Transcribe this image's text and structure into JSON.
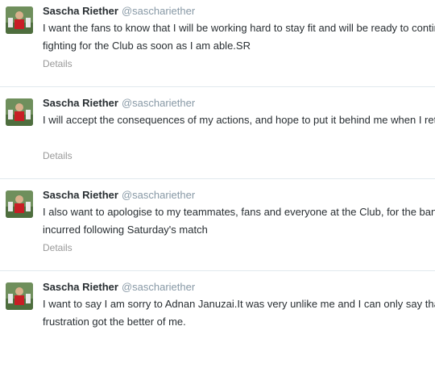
{
  "tweets": [
    {
      "name": "Sascha Riether",
      "handle": "@saschariether",
      "text": "I want the fans to know that I will be working hard to stay fit and will be ready to continue fighting for the Club as soon as I am able.SR",
      "details_label": "Details"
    },
    {
      "name": "Sascha Riether",
      "handle": "@saschariether",
      "text": "I will accept the consequences of my actions, and hope to put it behind me when I return.",
      "details_label": "Details"
    },
    {
      "name": "Sascha Riether",
      "handle": "@saschariether",
      "text": "I also want to apologise to my teammates, fans and everyone at the Club, for the ban incurred following Saturday's match",
      "details_label": "Details"
    },
    {
      "name": "Sascha Riether",
      "handle": "@saschariether",
      "text": "I want to say I am sorry to Adnan Januzai.It was very unlike me and I can only say that frustration got the better of me.",
      "details_label": ""
    }
  ],
  "colors": {
    "name": "#292f33",
    "handle": "#8899a6",
    "details": "#999999",
    "divider": "#e1e8ed"
  },
  "icons": {
    "avatar": "player-photo-avatar"
  }
}
